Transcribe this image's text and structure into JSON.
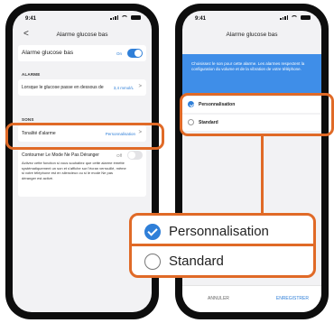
{
  "left_screen": {
    "status_time": "9:41",
    "nav_back": "<",
    "title": "Alarme glucose bas",
    "toggle_label": "Alarme glucose bas",
    "toggle_state": "On",
    "section_alarme": "ALARME",
    "threshold_label": "Lorsque le glucose passe en dessous de",
    "threshold_value": "3,4 mmol/L",
    "section_sons": "SONS",
    "tone_label": "Tonalité d'alarme",
    "tone_value": "Personnalisation",
    "dnd_label": "Contourner Le Mode Ne Pas Déranger",
    "dnd_state": "Off",
    "dnd_description": "Activez cette fonction si vous souhaitez que cette alarme émette systématiquement un son et s'affiche sur l'écran verrouillé, même si votre téléphone est en silencieux ou si le mode Ne pas déranger est activé.",
    "chevron": ">"
  },
  "right_screen": {
    "status_time": "9:41",
    "title": "Alarme glucose bas",
    "banner_text": "Choisissez le son pour cette alarme. Les alarmes respectent la configuration du volume et de la vibration de votre téléphone.",
    "options": [
      {
        "label": "Personnalisation",
        "selected": true
      },
      {
        "label": "Standard",
        "selected": false
      }
    ],
    "cancel_label": "ANNULER",
    "save_label": "ENREGISTRER"
  },
  "zoom_callout": {
    "options": [
      {
        "label": "Personnalisation",
        "selected": true
      },
      {
        "label": "Standard",
        "selected": false
      }
    ]
  },
  "colors": {
    "accent": "#2f7fd8",
    "highlight": "#e06a27",
    "banner": "#3f8ee8"
  }
}
